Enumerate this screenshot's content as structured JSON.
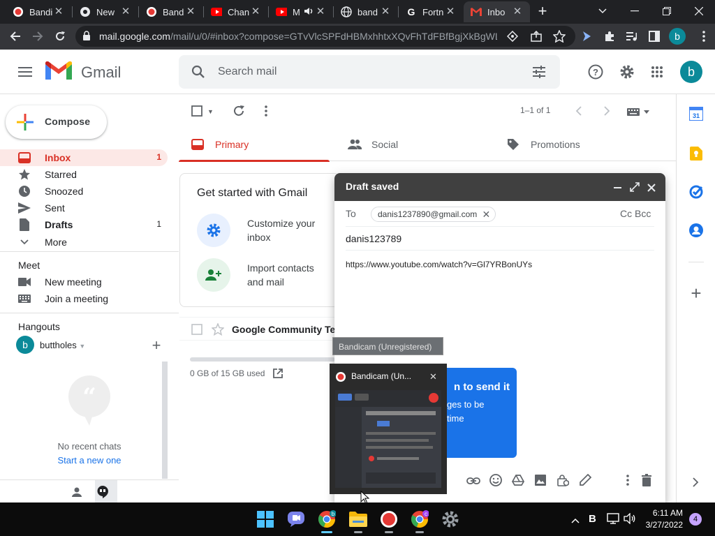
{
  "browser": {
    "tabs": [
      {
        "label": "Bandi",
        "icon": "bandicam-icon"
      },
      {
        "label": "New",
        "icon": "chrome-icon"
      },
      {
        "label": "Band",
        "icon": "bandicam-icon"
      },
      {
        "label": "Chan",
        "icon": "youtube-icon"
      },
      {
        "label": "M",
        "icon": "youtube-icon"
      },
      {
        "label": "band",
        "icon": "globe-icon"
      },
      {
        "label": "Fortn",
        "icon": "google-g-icon"
      },
      {
        "label": "Inbo",
        "icon": "gmail-icon",
        "active": true
      }
    ],
    "url_host": "mail.google.com",
    "url_path": "/mail/u/0/#inbox?compose=GTvVlcSPFdHBMxhhtxXQvFhTdFBfBgjXkBgWL...",
    "profile_letter": "b"
  },
  "gmail": {
    "product": "Gmail",
    "search_placeholder": "Search mail",
    "account_letter": "b",
    "compose_label": "Compose",
    "nav": [
      {
        "label": "Inbox",
        "count": "1",
        "icon": "inbox-icon",
        "active": true
      },
      {
        "label": "Starred",
        "count": "",
        "icon": "star-icon"
      },
      {
        "label": "Snoozed",
        "count": "",
        "icon": "clock-icon"
      },
      {
        "label": "Sent",
        "count": "",
        "icon": "send-icon"
      },
      {
        "label": "Drafts",
        "count": "1",
        "icon": "draft-icon",
        "bold": true
      },
      {
        "label": "More",
        "count": "",
        "icon": "chevron-down-icon"
      }
    ],
    "meet": {
      "heading": "Meet",
      "items": [
        {
          "label": "New meeting",
          "icon": "video-icon"
        },
        {
          "label": "Join a meeting",
          "icon": "keyboard-icon"
        }
      ]
    },
    "hangouts": {
      "heading": "Hangouts",
      "user": "buttholes",
      "user_letter": "b",
      "empty_text": "No recent chats",
      "start_link": "Start a new one"
    },
    "list_toolbar": {
      "pagination": "1–1 of 1"
    },
    "categories": [
      {
        "label": "Primary",
        "icon": "inbox-icon",
        "active": true
      },
      {
        "label": "Social",
        "icon": "people-icon"
      },
      {
        "label": "Promotions",
        "icon": "tag-icon"
      }
    ],
    "get_started": {
      "title": "Get started with Gmail",
      "items": [
        {
          "label": "Customize your inbox",
          "icon": "gear-icon"
        },
        {
          "label": "Import contacts and mail",
          "icon": "add-person-icon"
        }
      ]
    },
    "emails": [
      {
        "sender": "Google Community Te..."
      }
    ],
    "storage": "0 GB of 15 GB used",
    "compose_window": {
      "title": "Draft saved",
      "to_label": "To",
      "recipient": "danis1237890@gmail.com",
      "cc_bcc": "Cc Bcc",
      "subject": "danis123789",
      "body": "https://www.youtube.com/watch?v=Gl7YRBonUYs",
      "schedule_tip_line1": "n to send it",
      "schedule_tip_line2": "ges to be",
      "schedule_tip_line3": "time"
    }
  },
  "overlay": {
    "tooltip": "Bandicam (Unregistered)",
    "thumb_title": "Bandicam (Un..."
  },
  "taskbar": {
    "time": "6:11 AM",
    "date": "3/27/2022",
    "notifications": "4"
  },
  "colors": {
    "gmail_red": "#d93025",
    "chrome_dark": "#202124",
    "accent_blue": "#1a73e8",
    "avatar_teal": "#0b8a99"
  }
}
